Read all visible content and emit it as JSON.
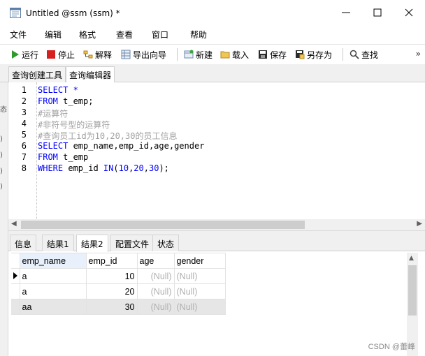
{
  "window": {
    "title": "Untitled @ssm (ssm) *",
    "controls": {
      "minimize": "—",
      "maximize": "☐",
      "close": "✕"
    }
  },
  "menu": [
    "文件",
    "编辑",
    "格式",
    "查看",
    "窗口",
    "帮助"
  ],
  "toolbar": {
    "run": "运行",
    "stop": "停止",
    "explain": "解释",
    "export_wizard": "导出向导",
    "new": "新建",
    "load": "载入",
    "save": "保存",
    "save_as": "另存为",
    "find": "查找",
    "more": "»",
    "colors": {
      "run": "#2e9a2e",
      "stop": "#d62020"
    }
  },
  "tabs": {
    "query_builder": "查询创建工具",
    "query_editor": "查询编辑器",
    "active": "query_editor"
  },
  "left_strip_glyphs": [
    "态",
    ")",
    ")",
    ")",
    ")"
  ],
  "editor": {
    "line_numbers": [
      "1",
      "2",
      "3",
      "4",
      "5",
      "6",
      "7",
      "8"
    ],
    "lines": [
      [
        {
          "t": "SELECT *",
          "c": "kw"
        }
      ],
      [
        {
          "t": "FROM",
          "c": "kw"
        },
        {
          "t": " t_emp;",
          "c": ""
        }
      ],
      [
        {
          "t": "#运算符",
          "c": "cm"
        }
      ],
      [
        {
          "t": "#非符号型的运算符",
          "c": "cm"
        }
      ],
      [
        {
          "t": "#查询员工id为10,20,30的员工信息",
          "c": "cm"
        }
      ],
      [
        {
          "t": "SELECT",
          "c": "kw"
        },
        {
          "t": " emp_name,emp_id,age,gender",
          "c": ""
        }
      ],
      [
        {
          "t": "FROM",
          "c": "kw"
        },
        {
          "t": " t_emp",
          "c": ""
        }
      ],
      [
        {
          "t": "WHERE",
          "c": "kw"
        },
        {
          "t": " emp_id ",
          "c": ""
        },
        {
          "t": "IN",
          "c": "kw"
        },
        {
          "t": "(",
          "c": ""
        },
        {
          "t": "10",
          "c": "nm"
        },
        {
          "t": ",",
          "c": ""
        },
        {
          "t": "20",
          "c": "nm"
        },
        {
          "t": ",",
          "c": ""
        },
        {
          "t": "30",
          "c": "nm"
        },
        {
          "t": ");",
          "c": ""
        }
      ]
    ]
  },
  "result_tabs": [
    "信息",
    "结果1",
    "结果2",
    "配置文件",
    "状态"
  ],
  "active_result_tab": "结果2",
  "grid": {
    "columns": [
      "emp_name",
      "emp_id",
      "age",
      "gender"
    ],
    "rows": [
      [
        "a",
        "10",
        "(Null)",
        "(Null)"
      ],
      [
        "a",
        "20",
        "(Null)",
        "(Null)"
      ],
      [
        "aa",
        "30",
        "(Null)",
        "(Null)"
      ]
    ],
    "current_row": 0,
    "highlighted_row": 2
  },
  "watermark": "CSDN @蕾峰"
}
